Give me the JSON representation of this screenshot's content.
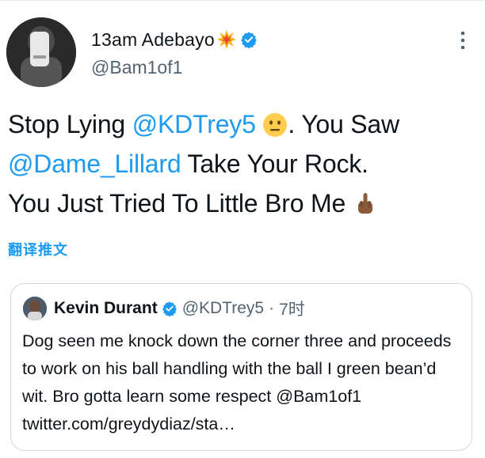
{
  "tweet": {
    "author_name": "13am Adebayo",
    "author_handle": "@Bam1of1",
    "text_segments": {
      "s1": "Stop Lying ",
      "m1": "@KDTrey5",
      "s2": ". You Saw",
      "m2": "@Dame_Lillard",
      "s3": " Take Your Rock.",
      "s4": "You Just Tried To Little Bro Me "
    },
    "translate_label": "翻译推文"
  },
  "quoted_tweet": {
    "author_name": "Kevin Durant",
    "author_handle": "@KDTrey5",
    "separator": "·",
    "time": "7时",
    "text": "Dog seen me knock down the corner three and proceeds to work on his ball handling with the ball I green bean’d wit. Bro gotta learn some respect @Bam1of1 twitter.com/greydydiaz/sta…"
  },
  "colors": {
    "link": "#1d9bf0",
    "secondary_text": "#536471",
    "border": "#cfd9de"
  },
  "icons": [
    "avatar",
    "collision-emoji",
    "verified-badge-icon",
    "more-options-icon",
    "neutral-face-emoji",
    "middle-finger-emoji"
  ]
}
